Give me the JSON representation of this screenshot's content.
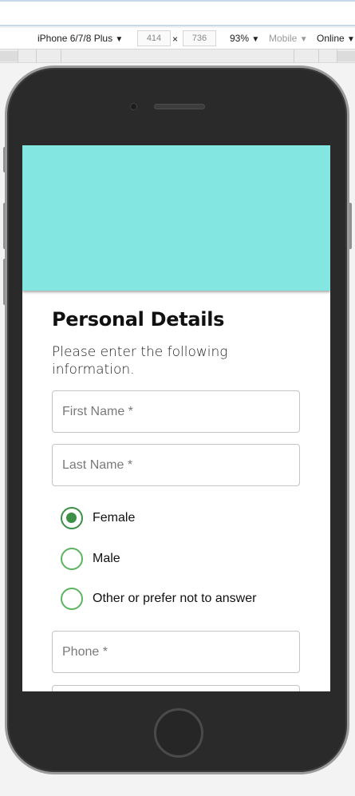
{
  "devtools": {
    "device": "iPhone 6/7/8 Plus",
    "width": "414",
    "height": "736",
    "times": "×",
    "zoom": "93%",
    "mode": "Mobile",
    "network": "Online",
    "caret": "▼"
  },
  "form": {
    "title": "Personal Details",
    "subtitle": "Please enter the following information.",
    "first_name_placeholder": "First Name *",
    "last_name_placeholder": "Last Name *",
    "phone_placeholder": "Phone *",
    "gender_options": [
      {
        "label": "Female",
        "selected": true
      },
      {
        "label": "Male",
        "selected": false
      },
      {
        "label": "Other or prefer not to answer",
        "selected": false
      }
    ]
  },
  "colors": {
    "hero": "#84e6e0",
    "radio_checked": "#3c8f45",
    "radio_unchecked": "#5bb45f"
  }
}
